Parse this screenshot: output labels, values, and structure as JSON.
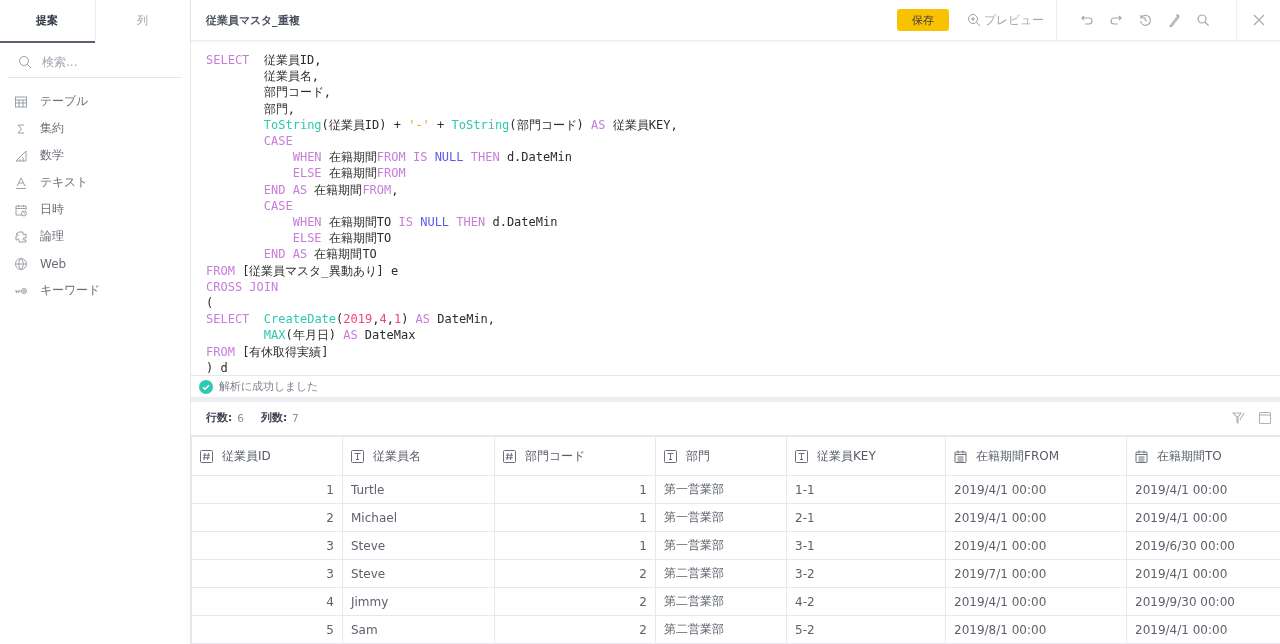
{
  "sidebar": {
    "tabs": [
      {
        "label": "提案",
        "selected": true
      },
      {
        "label": "列",
        "selected": false
      }
    ],
    "search": {
      "placeholder": "検索..."
    },
    "items": [
      {
        "kind": "table",
        "label": "テーブル"
      },
      {
        "kind": "aggregate",
        "label": "集約"
      },
      {
        "kind": "math",
        "label": "数学"
      },
      {
        "kind": "text",
        "label": "テキスト"
      },
      {
        "kind": "datetime",
        "label": "日時"
      },
      {
        "kind": "logic",
        "label": "論理"
      },
      {
        "kind": "web",
        "label": "Web"
      },
      {
        "kind": "keyword",
        "label": "キーワード"
      }
    ]
  },
  "header": {
    "title": "従業員マスタ_重複",
    "save": "保存",
    "preview": "プレビュー"
  },
  "code": [
    [
      {
        "kind": "kw",
        "text": "SELECT"
      },
      {
        "kind": "plain",
        "text": "  従業員ID,"
      }
    ],
    [
      {
        "kind": "plain",
        "text": "        従業員名,"
      }
    ],
    [
      {
        "kind": "plain",
        "text": "        部門コード,"
      }
    ],
    [
      {
        "kind": "plain",
        "text": "        部門,"
      }
    ],
    [
      {
        "kind": "fn",
        "text": "        ToString"
      },
      {
        "kind": "plain",
        "text": "(従業員ID) + "
      },
      {
        "kind": "str",
        "text": "'-'"
      },
      {
        "kind": "plain",
        "text": " + "
      },
      {
        "kind": "fn",
        "text": "ToString"
      },
      {
        "kind": "plain",
        "text": "(部門コード) "
      },
      {
        "kind": "kw",
        "text": "AS"
      },
      {
        "kind": "plain",
        "text": " 従業員KEY,"
      }
    ],
    [
      {
        "kind": "kw",
        "text": "        CASE"
      }
    ],
    [
      {
        "kind": "kw",
        "text": "            WHEN"
      },
      {
        "kind": "plain",
        "text": " 在籍期間"
      },
      {
        "kind": "kw",
        "text": "FROM IS "
      },
      {
        "kind": "null",
        "text": "NULL "
      },
      {
        "kind": "kw",
        "text": "THEN"
      },
      {
        "kind": "plain",
        "text": " d.DateMin"
      }
    ],
    [
      {
        "kind": "kw",
        "text": "            ELSE"
      },
      {
        "kind": "plain",
        "text": " 在籍期間"
      },
      {
        "kind": "kw",
        "text": "FROM"
      }
    ],
    [
      {
        "kind": "kw",
        "text": "        END AS"
      },
      {
        "kind": "plain",
        "text": " 在籍期間"
      },
      {
        "kind": "kw",
        "text": "FROM"
      },
      {
        "kind": "plain",
        "text": ","
      }
    ],
    [
      {
        "kind": "kw",
        "text": "        CASE"
      }
    ],
    [
      {
        "kind": "kw",
        "text": "            WHEN"
      },
      {
        "kind": "plain",
        "text": " 在籍期間TO "
      },
      {
        "kind": "kw",
        "text": "IS "
      },
      {
        "kind": "null",
        "text": "NULL "
      },
      {
        "kind": "kw",
        "text": "THEN"
      },
      {
        "kind": "plain",
        "text": " d.DateMin"
      }
    ],
    [
      {
        "kind": "kw",
        "text": "            ELSE"
      },
      {
        "kind": "plain",
        "text": " 在籍期間TO"
      }
    ],
    [
      {
        "kind": "kw",
        "text": "        END AS"
      },
      {
        "kind": "plain",
        "text": " 在籍期間TO"
      }
    ],
    [
      {
        "kind": "kw",
        "text": "FROM"
      },
      {
        "kind": "plain",
        "text": " [従業員マスタ_異動あり] e"
      }
    ],
    [
      {
        "kind": "kw",
        "text": "CROSS JOIN"
      }
    ],
    [
      {
        "kind": "plain",
        "text": "("
      }
    ],
    [
      {
        "kind": "kw",
        "text": "SELECT"
      },
      {
        "kind": "fn",
        "text": "  CreateDate"
      },
      {
        "kind": "plain",
        "text": "("
      },
      {
        "kind": "num",
        "text": "2019"
      },
      {
        "kind": "plain",
        "text": ","
      },
      {
        "kind": "num",
        "text": "4"
      },
      {
        "kind": "plain",
        "text": ","
      },
      {
        "kind": "num",
        "text": "1"
      },
      {
        "kind": "plain",
        "text": ") "
      },
      {
        "kind": "kw",
        "text": "AS"
      },
      {
        "kind": "plain",
        "text": " DateMin,"
      }
    ],
    [
      {
        "kind": "fn",
        "text": "        MAX"
      },
      {
        "kind": "plain",
        "text": "(年月日) "
      },
      {
        "kind": "kw",
        "text": "AS"
      },
      {
        "kind": "plain",
        "text": " DateMax"
      }
    ],
    [
      {
        "kind": "kw",
        "text": "FROM"
      },
      {
        "kind": "plain",
        "text": " [有休取得実績]"
      }
    ],
    [
      {
        "kind": "plain",
        "text": ") d"
      }
    ]
  ],
  "status": {
    "message": "解析に成功しました"
  },
  "summary": {
    "rows_label": "行数:",
    "rows": "6",
    "cols_label": "列数:",
    "cols": "7"
  },
  "table": {
    "columns": [
      {
        "kind": "number",
        "label": "従業員ID"
      },
      {
        "kind": "text",
        "label": "従業員名"
      },
      {
        "kind": "number",
        "label": "部門コード"
      },
      {
        "kind": "text",
        "label": "部門"
      },
      {
        "kind": "text",
        "label": "従業員KEY"
      },
      {
        "kind": "date",
        "label": "在籍期間FROM"
      },
      {
        "kind": "date",
        "label": "在籍期間TO"
      }
    ],
    "rows": [
      [
        "1",
        "Turtle",
        "1",
        "第一営業部",
        "1-1",
        "2019/4/1 00:00",
        "2019/4/1 00:00"
      ],
      [
        "2",
        "Michael",
        "1",
        "第一営業部",
        "2-1",
        "2019/4/1 00:00",
        "2019/4/1 00:00"
      ],
      [
        "3",
        "Steve",
        "1",
        "第一営業部",
        "3-1",
        "2019/4/1 00:00",
        "2019/6/30 00:00"
      ],
      [
        "3",
        "Steve",
        "2",
        "第二営業部",
        "3-2",
        "2019/7/1 00:00",
        "2019/4/1 00:00"
      ],
      [
        "4",
        "Jimmy",
        "2",
        "第二営業部",
        "4-2",
        "2019/4/1 00:00",
        "2019/9/30 00:00"
      ],
      [
        "5",
        "Sam",
        "2",
        "第二営業部",
        "5-2",
        "2019/8/1 00:00",
        "2019/4/1 00:00"
      ]
    ]
  }
}
